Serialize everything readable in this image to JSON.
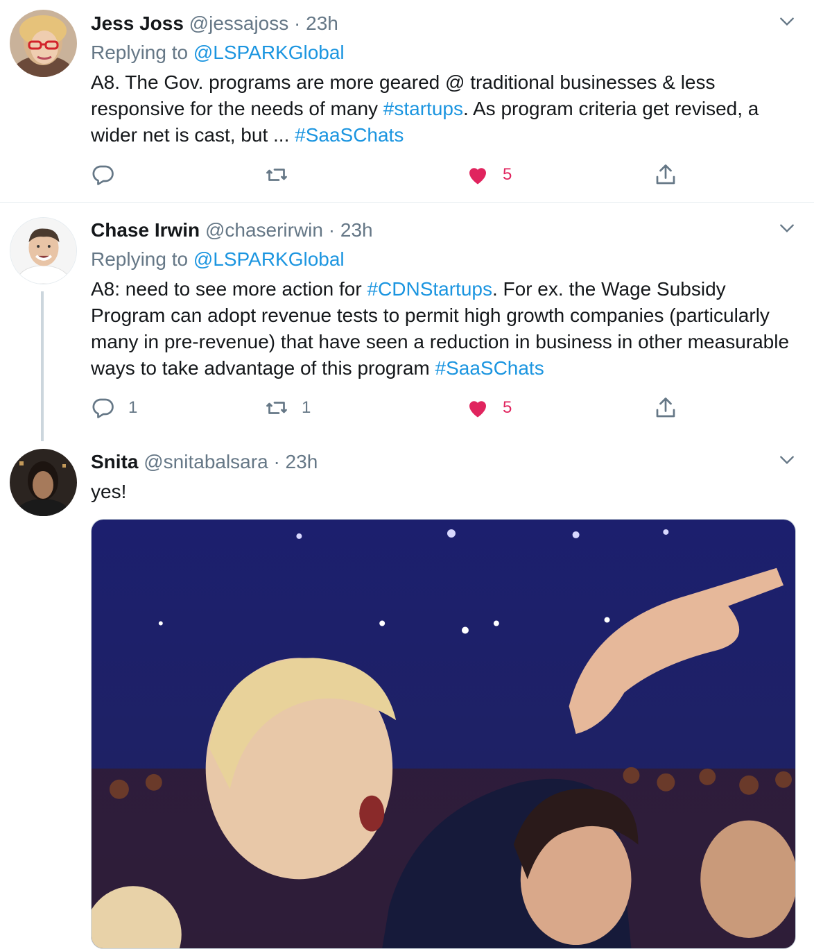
{
  "tweets": [
    {
      "name": "Jess Joss",
      "handle": "@jessajoss",
      "separator": "·",
      "time": "23h",
      "replying_prefix": "Replying to",
      "replying_to": "@LSPARKGlobal",
      "text_parts": [
        "A8. The Gov. programs are more geared @ traditional businesses & less responsive for the needs of many ",
        "#startups",
        ".  As program criteria get revised, a wider net is cast, but ... ",
        "#SaaSChats"
      ],
      "reply_count": "",
      "retweet_count": "",
      "like_count": "5",
      "liked": true,
      "avatar_icon": "profile-photo"
    },
    {
      "name": "Chase Irwin",
      "handle": "@chaserirwin",
      "separator": "·",
      "time": "23h",
      "replying_prefix": "Replying to",
      "replying_to": "@LSPARKGlobal",
      "text_parts": [
        "A8: need to see more action for ",
        "#CDNStartups",
        ". For ex. the Wage Subsidy Program can adopt revenue tests to permit high growth companies (particularly many in pre-revenue) that have seen a reduction in business in other measurable ways to take advantage of this program ",
        "#SaaSChats"
      ],
      "reply_count": "1",
      "retweet_count": "1",
      "like_count": "5",
      "liked": true,
      "avatar_icon": "profile-photo"
    },
    {
      "name": "Snita",
      "handle": "@snitabalsara",
      "separator": "·",
      "time": "23h",
      "text": "yes!",
      "media_icon": "gif-image"
    }
  ],
  "icons": {
    "caret": "chevron-down-icon",
    "reply": "reply-bubble-icon",
    "retweet": "retweet-icon",
    "like": "heart-icon",
    "share": "share-icon"
  },
  "colors": {
    "link": "#1b95e0",
    "muted": "#657786",
    "like": "#e0245e",
    "text": "#14171a"
  }
}
